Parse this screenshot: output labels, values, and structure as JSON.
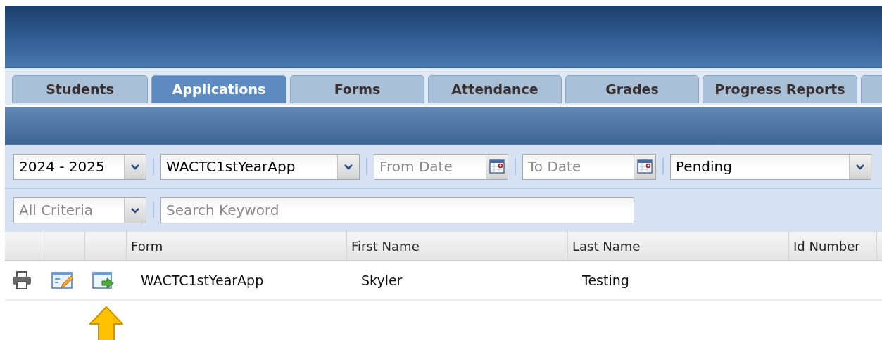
{
  "tabs": [
    {
      "label": "Students",
      "selected": false
    },
    {
      "label": "Applications",
      "selected": true
    },
    {
      "label": "Forms",
      "selected": false
    },
    {
      "label": "Attendance",
      "selected": false
    },
    {
      "label": "Grades",
      "selected": false
    },
    {
      "label": "Progress Reports",
      "selected": false
    }
  ],
  "filters": {
    "year": {
      "value": "2024 - 2025"
    },
    "form": {
      "value": "WACTC1stYearApp"
    },
    "from_date": {
      "placeholder": "From Date"
    },
    "to_date": {
      "placeholder": "To Date"
    },
    "status": {
      "value": "Pending"
    },
    "criteria": {
      "placeholder": "All Criteria"
    },
    "search": {
      "placeholder": "Search Keyword"
    }
  },
  "table": {
    "columns": [
      "Form",
      "First Name",
      "Last Name",
      "Id Number"
    ],
    "rows": [
      {
        "cells": [
          "WACTC1stYearApp",
          "Skyler",
          "Testing"
        ]
      }
    ]
  }
}
